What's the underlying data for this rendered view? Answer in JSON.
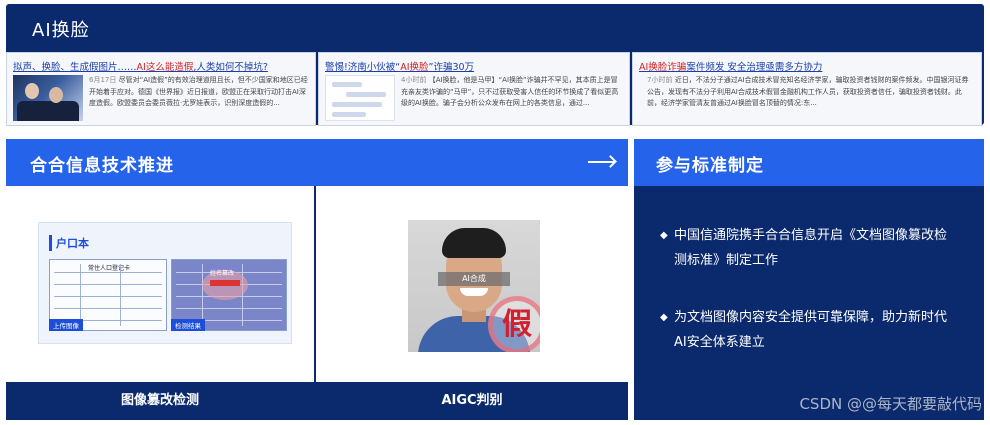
{
  "banner": {
    "title": "AI换脸",
    "news": [
      {
        "headline_pre": "拟声、换脸、生成假图片……",
        "headline_red": "AI这么能造假",
        "headline_post": ",人类如何不掉坑?",
        "time": "6月17日",
        "body": "尽管对“AI造假”的有效治理道阻且长，但不少国家和地区已经开始着手应对。德国《世界报》近日报道，欧盟正在采取行动打击AI深度造假。欧盟委员会委员薇拉·尤罗娃表示，识别深度造假的..."
      },
      {
        "headline_pre": "警惕!济南小伙被“",
        "headline_red": "AI换脸",
        "headline_post": "”诈骗30万",
        "time": "4小时前",
        "body": "【AI换脸，他是马甲】“AI换脸”诈骗并不罕见，其本质上是冒充亲友类诈骗的“马甲”，只不过获取受害人信任的环节换成了看似更高级的AI换脸。骗子会分析公众发布在网上的各类信息，通过..."
      },
      {
        "headline_pre": "",
        "headline_red": "AI换脸诈骗",
        "headline_post": "案件频发 安全治理亟需多方协力",
        "time": "7小时前",
        "body": "近日，不法分子通过AI合成技术冒充知名经济学家，骗取投资者钱财的案件频发。中国银河证券公告，发现有不法分子利用AI合成技术假冒金融机构工作人员，获取投资者信任，骗取投资者钱财。此前，经济学家管清友曾通过AI换脸冒名顶替的情况:东..."
      }
    ]
  },
  "left_section": {
    "title": "合合信息技术推进",
    "demos": [
      {
        "caption": "图像篡改检测",
        "doc_title": "户口本",
        "upload_tag": "上传图像",
        "result_tag": "检测结果",
        "detected_label": "姓名篡改",
        "form_title": "常住人口登记卡"
      },
      {
        "caption": "AIGC判别",
        "eye_text": "AI合成",
        "stamp": "假"
      }
    ]
  },
  "right_section": {
    "title": "参与标准制定",
    "bullets": [
      "中国信通院携手合合信息开启《文档图像篡改检测标准》制定工作",
      "为文档图像内容安全提供可靠保障，助力新时代AI安全体系建立"
    ],
    "bullet_marker": "◆"
  },
  "watermark": "CSDN @@每天都要敲代码"
}
